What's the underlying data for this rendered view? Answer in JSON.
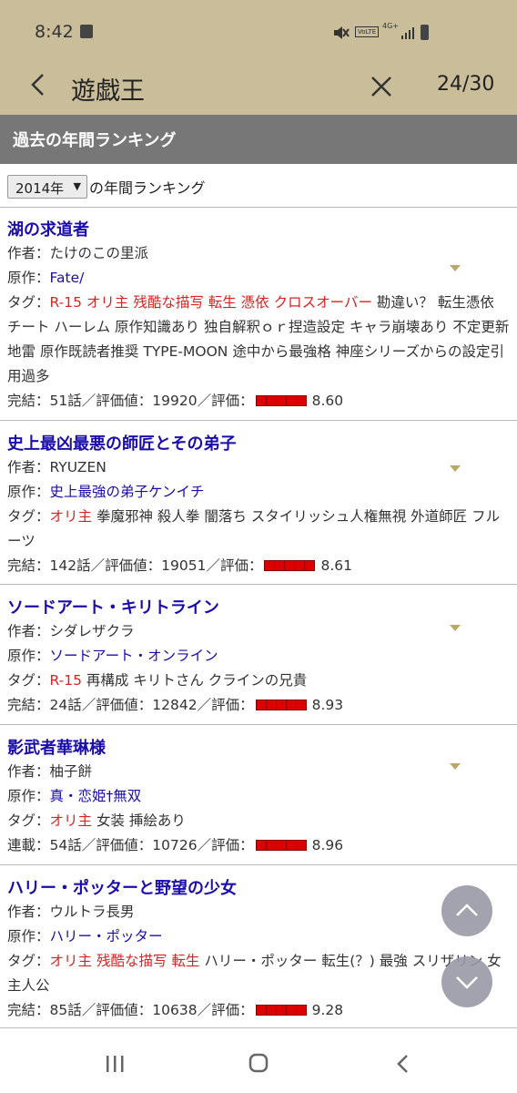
{
  "status": {
    "time": "8:42",
    "volte": "VoLTE",
    "network": "4G+"
  },
  "app": {
    "title": "遊戯王",
    "page_count": "24/30"
  },
  "section": {
    "header": "過去の年間ランキング"
  },
  "selector": {
    "year": "2014年",
    "suffix": "の年間ランキング"
  },
  "labels": {
    "author": "作者：",
    "source": "原作：",
    "tags": "タグ：",
    "stat_sep": "話／評価値：",
    "rating": "／評価："
  },
  "entries": [
    {
      "title": "湖の求道者",
      "author": "たけのこの里派",
      "source": "Fate/",
      "red_tags": "R-15 オリ主 残酷な描写 転生 憑依 クロスオーバー",
      "tags": "勘違い？ 転生憑依 チート ハーレム 原作知識あり 独自解釈ｏｒ捏造設定 キャラ崩壊あり 不定更新 地雷 原作既読者推奨 TYPE-MOON 途中から最強格 神座シリーズからの設定引用過多",
      "status": "完結：",
      "episodes": "51",
      "points": "19920",
      "rating": "8.60"
    },
    {
      "title": "史上最凶最悪の師匠とその弟子",
      "author": "RYUZEN",
      "source": "史上最強の弟子ケンイチ",
      "red_tags": "オリ主",
      "tags": "拳魔邪神 殺人拳 闇落ち スタイリッシュ人権無視 外道師匠 フルーツ",
      "status": "完結：",
      "episodes": "142",
      "points": "19051",
      "rating": "8.61"
    },
    {
      "title": "ソードアート・キリトライン",
      "author": "シダレザクラ",
      "source": "ソードアート・オンライン",
      "red_tags": "R-15",
      "tags": "再構成 キリトさん クラインの兄貴",
      "status": "完結：",
      "episodes": "24",
      "points": "12842",
      "rating": "8.93"
    },
    {
      "title": "影武者華琳様",
      "author": "柚子餅",
      "source": "真・恋姫†無双",
      "red_tags": "オリ主",
      "tags": "女装 挿絵あり",
      "status": "連載：",
      "episodes": "54",
      "points": "10726",
      "rating": "8.96"
    },
    {
      "title": "ハリー・ポッターと野望の少女",
      "author": "ウルトラ長男",
      "source": "ハリー・ポッター",
      "red_tags": "オリ主 残酷な描写 転生",
      "tags": "ハリー・ポッター 転生(？) 最強 スリザリン 女主人公",
      "status": "完結：",
      "episodes": "85",
      "points": "10638",
      "rating": "9.28"
    }
  ],
  "colors": {
    "toolbar": "#c9bd9a",
    "header": "#777777",
    "link": "#1a0dab",
    "tag_red": "#d22222",
    "rating_bar": "#dd0000"
  }
}
